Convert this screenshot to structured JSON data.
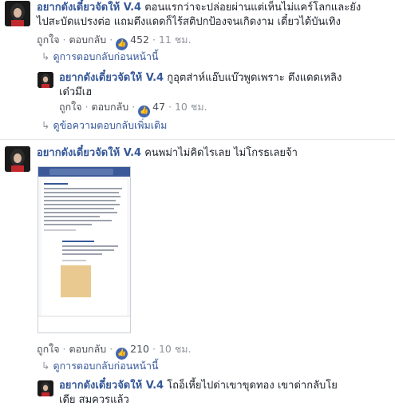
{
  "comments": [
    {
      "author": "อยากดังเดี๋ยวจัดให้ V.4",
      "text_line1": " ตอนแรกว่าจะปล่อยผ่านแต่เห็นไม่แคร์โลกและยัง",
      "text_line2": "ไปสะบัดแปรงต่อ แถมตึงแดดก็ไร้สติปกป้องจนเกิดงาม เดี๋ยวได้บันเทิง",
      "like_label": "ถูกใจ",
      "reply_label": "ตอบกลับ",
      "like_count": "452",
      "time": "11 ชม.",
      "view_previous_replies": "ดูการตอบกลับก่อนหน้านี้"
    },
    {
      "author": "อยากดังเดี๋ยวจัดให้ V.4",
      "text_line1": " กูอุตส่าห์แอ๊บแบ๊วพูดเพราะ ตึงแดดเหลิง",
      "text_line2": "เด๋วมึเฮ",
      "like_label": "ถูกใจ",
      "reply_label": "ตอบกลับ",
      "like_count": "47",
      "time": "10 ชม.",
      "view_more_replies": "ดูข้อความตอบกลับเพิ่มเติม"
    },
    {
      "author": "อยากดังเดี๋ยวจัดให้ V.4",
      "text_line1": " คนพม่าไม่คิดไรเลย ไม่โกรธเลยจ้า",
      "like_label": "ถูกใจ",
      "reply_label": "ตอบกลับ",
      "like_count": "210",
      "time": "10 ชม.",
      "view_previous_replies": "ดูการตอบกลับก่อนหน้านี้"
    },
    {
      "author": "อยากดังเดี๋ยวจัดให้ V.4",
      "text_line1": " โถอ็เหี้ยไปด่าเขาขุดทอง เขาด่ากลับโย",
      "text_line2": "เดีย สมควรแล้ว"
    }
  ],
  "colors": {
    "author": "#365899",
    "meta": "#90949c",
    "like_badge": "#4267b2"
  },
  "icons": {
    "like": "thumbs-up-icon",
    "reply_arrow": "reply-arrow-icon"
  }
}
